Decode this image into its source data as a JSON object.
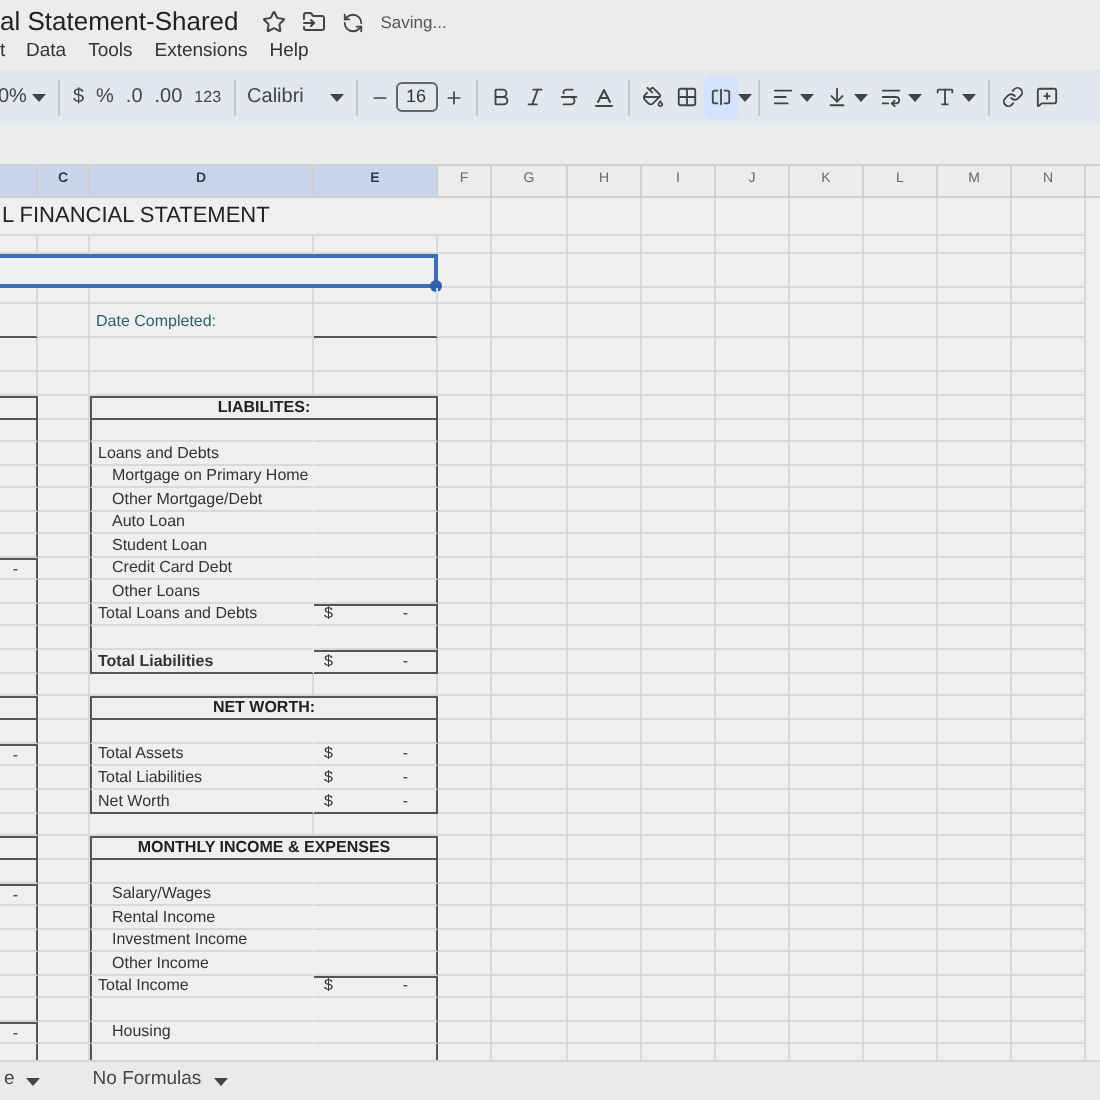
{
  "document": {
    "title": "al Statement-Shared",
    "status": "Saving..."
  },
  "menu": [
    "t",
    "Data",
    "Tools",
    "Extensions",
    "Help"
  ],
  "toolbar": {
    "zoom": "0%",
    "currency": "$",
    "percent": "%",
    "decrease_decimal": ".0",
    "increase_decimal": ".00",
    "number_format": "123",
    "font": "Calibri",
    "font_size": "16",
    "merge_active": true
  },
  "left_edge_column": {
    "selected": true
  },
  "columns": [
    {
      "label": "C",
      "selected": true
    },
    {
      "label": "D",
      "selected": true
    },
    {
      "label": "E",
      "selected": true
    },
    {
      "label": "F",
      "selected": false
    },
    {
      "label": "G",
      "selected": false
    },
    {
      "label": "H",
      "selected": false
    },
    {
      "label": "I",
      "selected": false
    },
    {
      "label": "J",
      "selected": false
    },
    {
      "label": "K",
      "selected": false
    },
    {
      "label": "L",
      "selected": false
    },
    {
      "label": "M",
      "selected": false
    },
    {
      "label": "N",
      "selected": false
    }
  ],
  "rows": [
    {
      "kind": "title",
      "label": "L FINANCIAL STATEMENT"
    },
    {
      "kind": "thin"
    },
    {
      "kind": "selection",
      "selected": true
    },
    {
      "kind": "thin"
    },
    {
      "kind": "date",
      "label": "Date Completed:"
    },
    {
      "kind": "tall"
    },
    {
      "kind": "gap"
    },
    {
      "kind": "header",
      "label": "LIABILITES:"
    },
    {
      "kind": "line"
    },
    {
      "kind": "line",
      "label": "Loans and Debts"
    },
    {
      "kind": "line",
      "label": "Mortgage on Primary Home",
      "indent": true
    },
    {
      "kind": "line",
      "label": "Other Mortgage/Debt",
      "indent": true
    },
    {
      "kind": "line",
      "label": "Auto Loan",
      "indent": true
    },
    {
      "kind": "line",
      "label": "Student Loan",
      "indent": true
    },
    {
      "kind": "line",
      "label": "Credit Card Debt",
      "indent": true,
      "column_b": "-"
    },
    {
      "kind": "line",
      "label": "Other Loans",
      "indent": true
    },
    {
      "kind": "line",
      "label": "Total Loans and Debts",
      "dollar": "$",
      "amount": "-",
      "rule": true
    },
    {
      "kind": "line"
    },
    {
      "kind": "last",
      "label": "Total Liabilities",
      "bold": true,
      "dollar": "$",
      "amount": "-",
      "rule": true
    },
    {
      "kind": "gap"
    },
    {
      "kind": "header",
      "label": "NET WORTH:"
    },
    {
      "kind": "line"
    },
    {
      "kind": "line",
      "label": "Total Assets",
      "dollar": "$",
      "amount": "-",
      "column_b": "-"
    },
    {
      "kind": "line",
      "label": "Total Liabilities",
      "dollar": "$",
      "amount": "-"
    },
    {
      "kind": "last",
      "label": "Net Worth",
      "dollar": "$",
      "amount": "-"
    },
    {
      "kind": "gap"
    },
    {
      "kind": "header",
      "label": "MONTHLY INCOME & EXPENSES"
    },
    {
      "kind": "line"
    },
    {
      "kind": "line",
      "label": "Salary/Wages",
      "indent": true,
      "column_b": "-"
    },
    {
      "kind": "line",
      "label": "Rental Income",
      "indent": true
    },
    {
      "kind": "line",
      "label": "Investment Income",
      "indent": true
    },
    {
      "kind": "line",
      "label": "Other Income",
      "indent": true
    },
    {
      "kind": "line",
      "label": "Total Income",
      "dollar": "$",
      "amount": "-",
      "rule": true
    },
    {
      "kind": "line"
    },
    {
      "kind": "line",
      "label": "Housing",
      "indent": true,
      "column_b": "-"
    },
    {
      "kind": "line"
    }
  ],
  "sheet_tabs": [
    {
      "label": "e",
      "selected": false
    },
    {
      "label": "No Formulas",
      "selected": false
    }
  ]
}
